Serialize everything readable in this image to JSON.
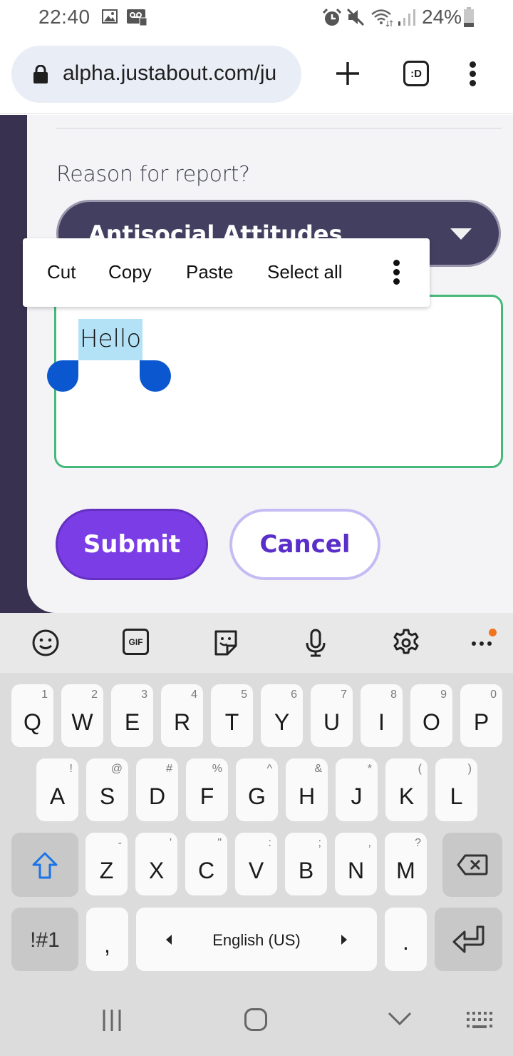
{
  "status_bar": {
    "time": "22:40",
    "left_icons": [
      "gallery-icon",
      "voicemail-icon"
    ],
    "right_icons": [
      "alarm-icon",
      "mute-icon",
      "wifi-icon",
      "signal-icon"
    ],
    "battery": "24%"
  },
  "browser": {
    "url": "alpha.justabout.com/ju",
    "new_tab_icon": "plus-icon",
    "tab_switcher_label": ":D",
    "menu_icon": "more-vert-icon"
  },
  "form": {
    "reason_label": "Reason for report?",
    "reason_selected": "Antisocial Attitudes",
    "details_value": "Hello",
    "submit_label": "Submit",
    "cancel_label": "Cancel"
  },
  "context_menu": {
    "items": [
      "Cut",
      "Copy",
      "Paste",
      "Select all"
    ],
    "more_icon": "more-vert-icon"
  },
  "keyboard": {
    "toolbar": [
      "emoji-icon",
      "gif-icon",
      "sticker-icon",
      "mic-icon",
      "settings-icon",
      "more-horiz-icon"
    ],
    "toolbar_gif_label": "GIF",
    "row1": [
      {
        "key": "Q",
        "hint": "1"
      },
      {
        "key": "W",
        "hint": "2"
      },
      {
        "key": "E",
        "hint": "3"
      },
      {
        "key": "R",
        "hint": "4"
      },
      {
        "key": "T",
        "hint": "5"
      },
      {
        "key": "Y",
        "hint": "6"
      },
      {
        "key": "U",
        "hint": "7"
      },
      {
        "key": "I",
        "hint": "8"
      },
      {
        "key": "O",
        "hint": "9"
      },
      {
        "key": "P",
        "hint": "0"
      }
    ],
    "row2": [
      {
        "key": "A",
        "hint": "!"
      },
      {
        "key": "S",
        "hint": "@"
      },
      {
        "key": "D",
        "hint": "#"
      },
      {
        "key": "F",
        "hint": "%"
      },
      {
        "key": "G",
        "hint": "^"
      },
      {
        "key": "H",
        "hint": "&"
      },
      {
        "key": "J",
        "hint": "*"
      },
      {
        "key": "K",
        "hint": "("
      },
      {
        "key": "L",
        "hint": ")"
      }
    ],
    "row3": [
      {
        "key": "Z",
        "hint": "-"
      },
      {
        "key": "X",
        "hint": "'"
      },
      {
        "key": "C",
        "hint": "\""
      },
      {
        "key": "V",
        "hint": ":"
      },
      {
        "key": "B",
        "hint": ";"
      },
      {
        "key": "N",
        "hint": ","
      },
      {
        "key": "M",
        "hint": "?"
      }
    ],
    "symbols_label": "!#1",
    "comma_label": ",",
    "space_label": "English (US)",
    "period_label": ".",
    "shift_color": "#1a73e8"
  },
  "nav_bar": [
    "recents-icon",
    "home-icon",
    "back-icon",
    "keyboard-switch-icon"
  ]
}
